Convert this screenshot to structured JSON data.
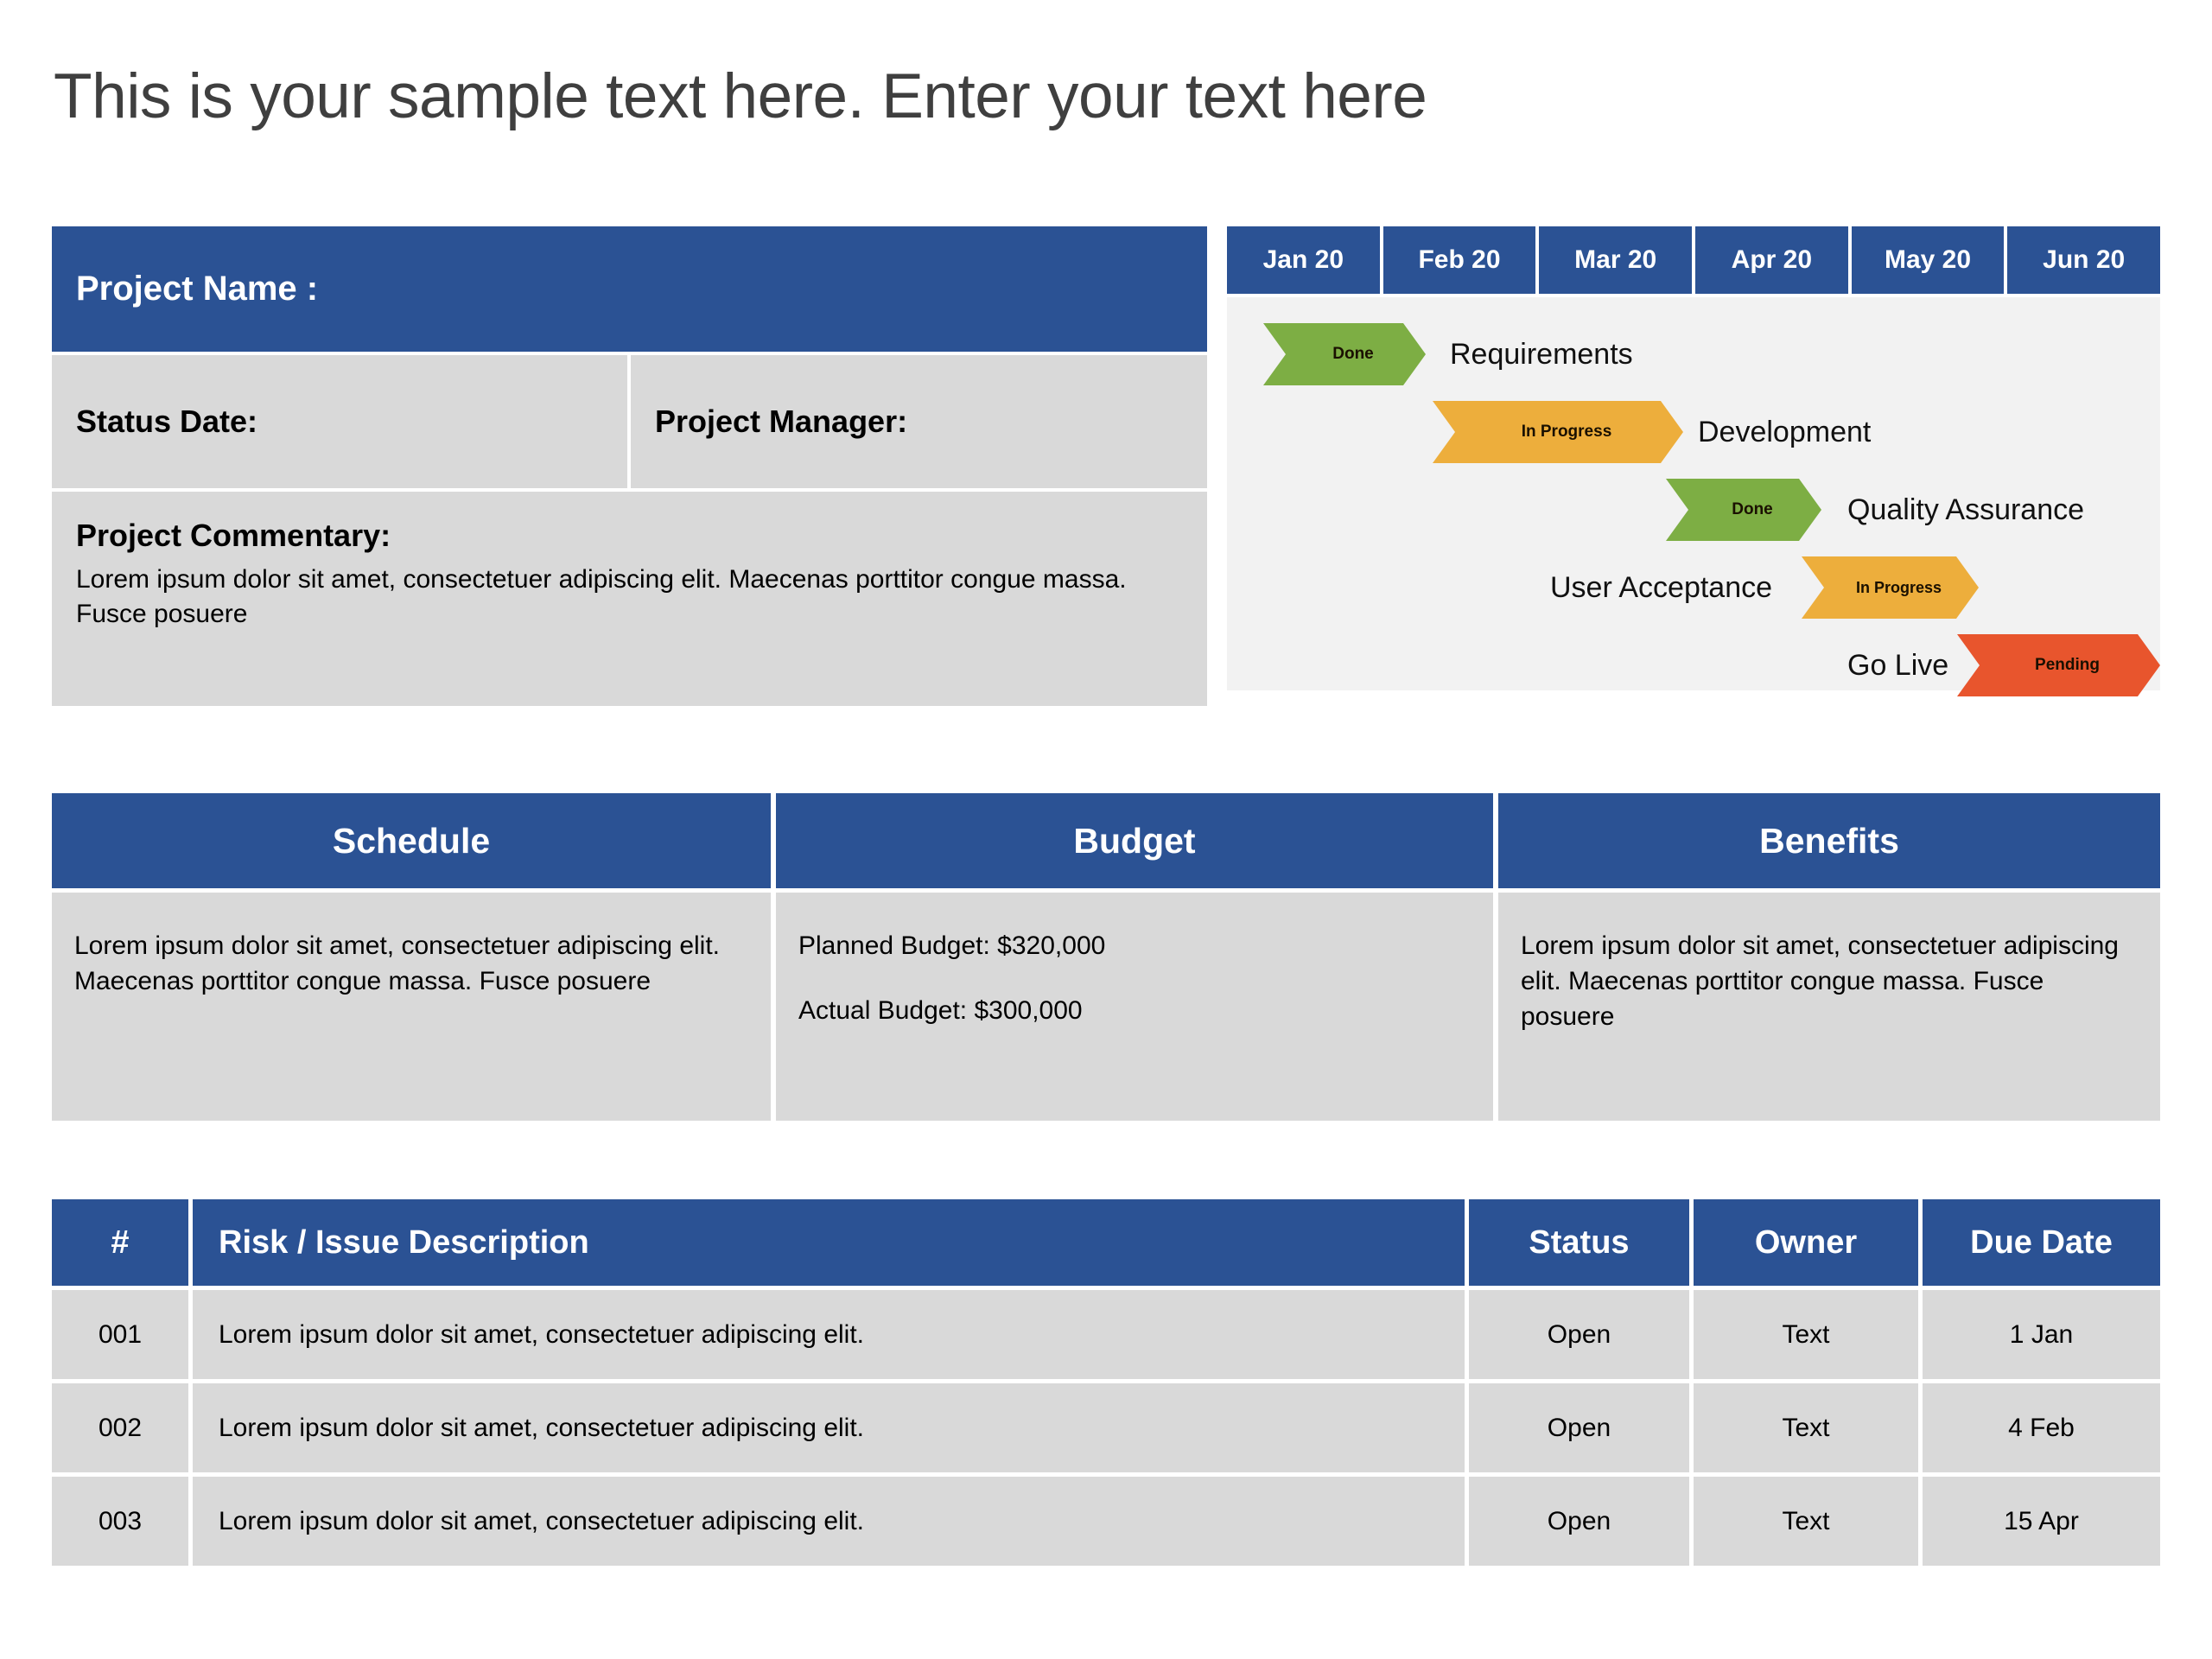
{
  "title": "This is your sample text here. Enter your text here",
  "project": {
    "name_label": "Project Name :",
    "status_date_label": "Status Date:",
    "project_manager_label": "Project Manager:",
    "commentary_label": "Project Commentary:",
    "commentary_text": "Lorem ipsum dolor sit amet, consectetuer adipiscing elit. Maecenas porttitor congue massa. Fusce posuere"
  },
  "gantt": {
    "months": [
      "Jan 20",
      "Feb 20",
      "Mar 20",
      "Apr 20",
      "May 20",
      "Jun 20"
    ],
    "tasks": [
      {
        "label": "Requirements",
        "status": "Done",
        "color": "#7DAE44",
        "color_name": "green"
      },
      {
        "label": "Development",
        "status": "In Progress",
        "color": "#EDAE3C",
        "color_name": "orange"
      },
      {
        "label": "Quality Assurance",
        "status": "Done",
        "color": "#7DAE44",
        "color_name": "green"
      },
      {
        "label": "User Acceptance",
        "status": "In Progress",
        "color": "#EDAE3C",
        "color_name": "orange"
      },
      {
        "label": "Go Live",
        "status": "Pending",
        "color": "#E8552D",
        "color_name": "red"
      }
    ]
  },
  "columns": [
    {
      "header": "Schedule",
      "text": "Lorem ipsum dolor sit amet, consectetuer adipiscing elit. Maecenas porttitor congue massa. Fusce posuere"
    },
    {
      "header": "Budget",
      "planned": "Planned Budget: $320,000",
      "actual": "Actual Budget: $300,000"
    },
    {
      "header": "Benefits",
      "text": "Lorem ipsum dolor sit amet, consectetuer adipiscing elit. Maecenas porttitor congue massa. Fusce posuere"
    }
  ],
  "risk_table": {
    "headers": {
      "num": "#",
      "description": "Risk / Issue Description",
      "status": "Status",
      "owner": "Owner",
      "due_date": "Due Date"
    },
    "rows": [
      {
        "num": "001",
        "description": "Lorem ipsum dolor sit amet, consectetuer adipiscing elit.",
        "status": "Open",
        "owner": "Text",
        "due_date": "1 Jan"
      },
      {
        "num": "002",
        "description": "Lorem ipsum dolor sit amet, consectetuer adipiscing elit.",
        "status": "Open",
        "owner": "Text",
        "due_date": "4 Feb"
      },
      {
        "num": "003",
        "description": "Lorem ipsum dolor sit amet, consectetuer adipiscing elit.",
        "status": "Open",
        "owner": "Text",
        "due_date": "15 Apr"
      }
    ]
  },
  "theme": {
    "blue": "#2B5294",
    "gray": "#D9D9D9",
    "light_gray": "#F2F2F2",
    "title_gray": "#3F3F3F"
  }
}
